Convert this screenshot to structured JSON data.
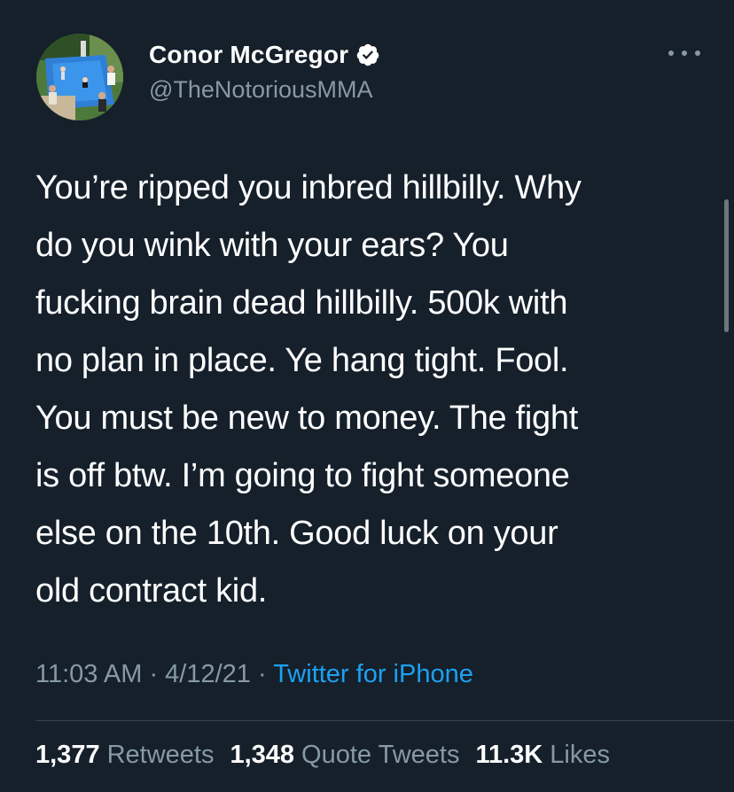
{
  "profile": {
    "display_name": "Conor McGregor",
    "handle": "@TheNotoriousMMA",
    "verified": true,
    "avatar_icon": "profile-photo"
  },
  "tweet": {
    "lines": [
      "You’re ripped you inbred hillbilly. Why",
      "do you wink with your ears? You",
      "fucking brain dead hillbilly. 500k with",
      "no plan in place. Ye hang tight. Fool.",
      "You must be new to money. The fight",
      "is off btw. I’m going to fight someone",
      "else on the 10th. Good luck on your",
      "old contract kid."
    ]
  },
  "meta": {
    "time": "11:03 AM",
    "separator": " · ",
    "date": "4/12/21",
    "source": "Twitter for iPhone"
  },
  "stats": {
    "retweets_count": "1,377",
    "retweets_label": "Retweets",
    "quote_count": "1,348",
    "quote_label": "Quote Tweets",
    "likes_count": "11.3K",
    "likes_label": "Likes"
  },
  "colors": {
    "background": "#15202b",
    "text": "#ffffff",
    "secondary": "#8899a6",
    "link": "#1da1f2"
  }
}
